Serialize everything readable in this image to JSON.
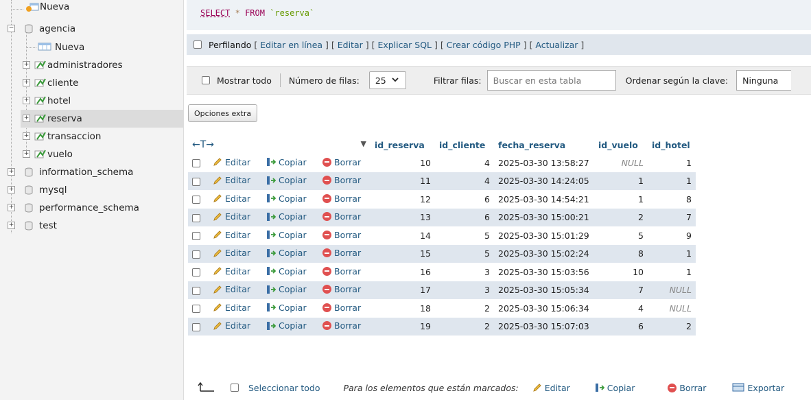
{
  "sidebar": {
    "items": [
      {
        "label": "Nueva"
      },
      {
        "label": "agencia"
      },
      {
        "label": "Nueva"
      },
      {
        "label": "administradores"
      },
      {
        "label": "cliente"
      },
      {
        "label": "hotel"
      },
      {
        "label": "reserva"
      },
      {
        "label": "transaccion"
      },
      {
        "label": "vuelo"
      },
      {
        "label": "information_schema"
      },
      {
        "label": "mysql"
      },
      {
        "label": "performance_schema"
      },
      {
        "label": "test"
      }
    ]
  },
  "query": {
    "select": "SELECT",
    "star": "*",
    "from": "FROM",
    "table": "`reserva`"
  },
  "profile": {
    "label": "Perfilando",
    "links": [
      "Editar en línea",
      "Editar",
      "Explicar SQL",
      "Crear código PHP",
      "Actualizar"
    ]
  },
  "nav": {
    "show_all": "Mostrar todo",
    "rows_label": "Número de filas:",
    "rows_value": "25",
    "filter_label": "Filtrar filas:",
    "filter_placeholder": "Buscar en esta tabla",
    "order_label": "Ordenar según la clave:",
    "order_value": "Ninguna"
  },
  "extra_options": "Opciones extra",
  "table": {
    "arrows": "←T→",
    "sort_indicator": "▼",
    "columns": [
      "id_reserva",
      "id_cliente",
      "fecha_reserva",
      "id_vuelo",
      "id_hotel"
    ],
    "actions": {
      "edit": "Editar",
      "copy": "Copiar",
      "delete": "Borrar"
    },
    "rows": [
      [
        "10",
        "4",
        "2025-03-30 13:58:27",
        "NULL",
        "1"
      ],
      [
        "11",
        "4",
        "2025-03-30 14:24:05",
        "1",
        "1"
      ],
      [
        "12",
        "6",
        "2025-03-30 14:54:21",
        "1",
        "8"
      ],
      [
        "13",
        "6",
        "2025-03-30 15:00:21",
        "2",
        "7"
      ],
      [
        "14",
        "5",
        "2025-03-30 15:01:29",
        "5",
        "9"
      ],
      [
        "15",
        "5",
        "2025-03-30 15:02:24",
        "8",
        "1"
      ],
      [
        "16",
        "3",
        "2025-03-30 15:03:56",
        "10",
        "1"
      ],
      [
        "17",
        "3",
        "2025-03-30 15:05:34",
        "7",
        "NULL"
      ],
      [
        "18",
        "2",
        "2025-03-30 15:06:34",
        "4",
        "NULL"
      ],
      [
        "19",
        "2",
        "2025-03-30 15:07:03",
        "6",
        "2"
      ]
    ]
  },
  "footer": {
    "select_all": "Seleccionar todo",
    "marked_label": "Para los elementos que están marcados:",
    "edit": "Editar",
    "copy": "Copiar",
    "delete": "Borrar",
    "export": "Exportar"
  }
}
